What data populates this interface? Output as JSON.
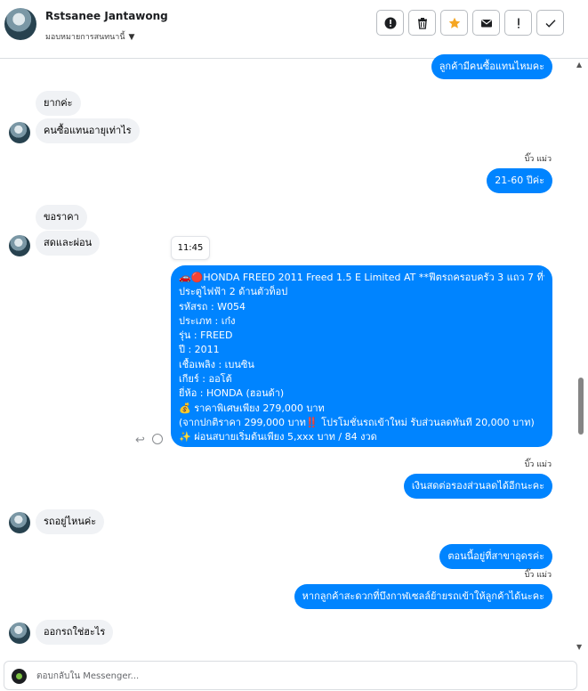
{
  "header": {
    "name": "Rstsanee Jantawong",
    "subtitle": "มอบหมายการสนทนานี้",
    "actions": [
      "alert-circle-icon",
      "trash-icon",
      "star-icon",
      "mail-icon",
      "exclamation-icon",
      "check-icon"
    ],
    "accent": "#f5a623"
  },
  "messages": {
    "m1": "ลูกค้ามีคนซื้อแทนไหมคะ",
    "m2": "ยากค่ะ",
    "m3": "คนซื้อแทนอายุเท่าไร",
    "seen1": "บิ๊ว แม่ว",
    "m4": "21-60 ปีค่ะ",
    "m5": "ขอราคา",
    "m6": "สดและผ่อน",
    "time": "11:45",
    "big": [
      "🚗🔴HONDA FREED 2011 Freed 1.5 E Limited AT **ฟีตรถครอบครัว 3 แถว 7 ที่นั่ง",
      "ประตูไฟฟ้า 2 ด้านตัวท็อป",
      "รหัสรถ : W054",
      "ประเภท : เก๋ง",
      "รุ่น : FREED",
      "ปี : 2011",
      "เชื้อเพลิง : เบนซิน",
      "เกียร์ : ออโต้",
      "ยี่ห้อ : HONDA (ฮอนด้า)",
      "💰 ราคาพิเศษเพียง 279,000 บาท",
      "(จากปกติราคา 299,000 บาท‼️ โปรโมชั่นรถเข้าใหม่ รับส่วนลดทันที 20,000 บาท)",
      "✨ ผ่อนสบายเริ่มต้นเพียง 5,xxx บาท / 84 งวด"
    ],
    "seen2": "บิ๊ว แม่ว",
    "m7": "เงินสดต่อรองส่วนลดได้อีกนะคะ",
    "m8": "รถอยู่ไหนค่ะ",
    "m9": "ตอนนี้อยู่ที่สาขาอุดรค่ะ",
    "seen3": "บิ๊ว แม่ว",
    "m10": "หากลูกค้าสะดวกที่บึงกาฬเซลล์ย้ายรถเข้าให้ลูกค้าได้นะคะ",
    "m11": "ออกรถใช่ฮะไร"
  },
  "composer": {
    "placeholder": "ตอบกลับใน Messenger..."
  }
}
